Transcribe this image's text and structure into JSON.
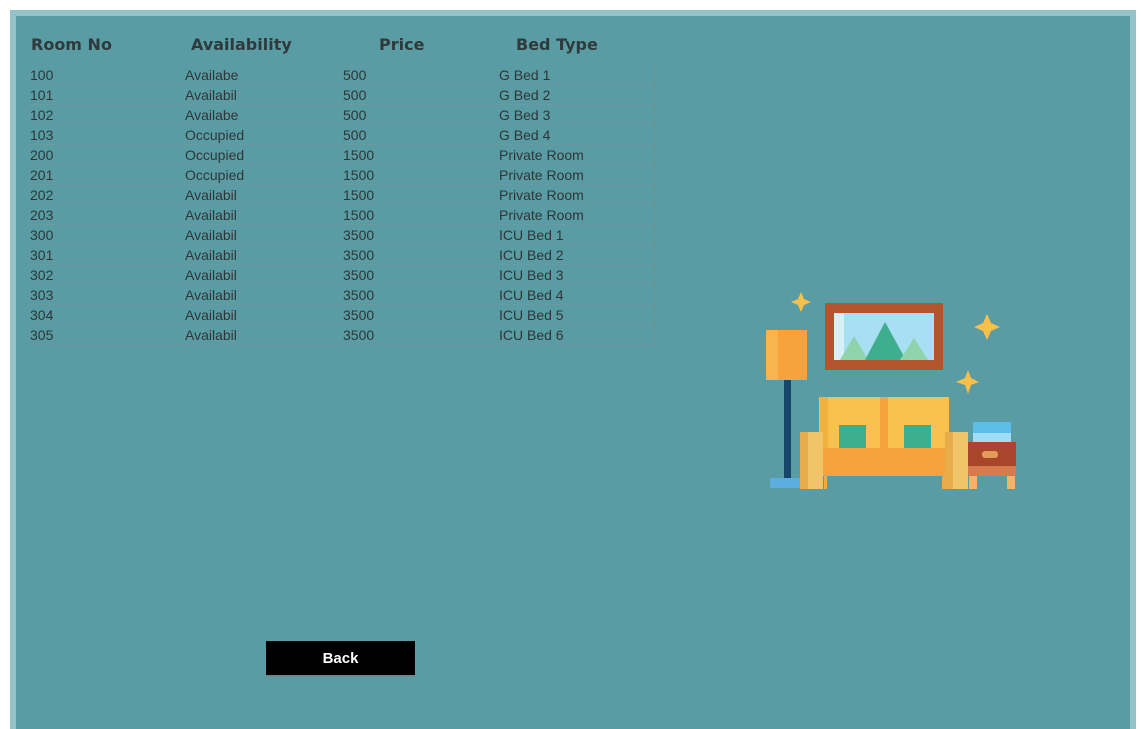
{
  "headers": {
    "room_no": "Room No",
    "availability": "Availability",
    "price": "Price",
    "bed_type": "Bed Type"
  },
  "rooms": [
    {
      "room": "100",
      "availability": "Availabe",
      "price": "500",
      "bed": "G Bed 1"
    },
    {
      "room": "101",
      "availability": "Availabil",
      "price": "500",
      "bed": "G Bed 2"
    },
    {
      "room": "102",
      "availability": "Availabe",
      "price": "500",
      "bed": "G Bed 3"
    },
    {
      "room": "103",
      "availability": "Occupied",
      "price": "500",
      "bed": "G Bed 4"
    },
    {
      "room": "200",
      "availability": "Occupied",
      "price": "1500",
      "bed": "Private Room"
    },
    {
      "room": "201",
      "availability": "Occupied",
      "price": "1500",
      "bed": "Private Room"
    },
    {
      "room": "202",
      "availability": "Availabil",
      "price": "1500",
      "bed": "Private Room"
    },
    {
      "room": "203",
      "availability": "Availabil",
      "price": "1500",
      "bed": "Private Room"
    },
    {
      "room": "300",
      "availability": "Availabil",
      "price": "3500",
      "bed": "ICU Bed 1"
    },
    {
      "room": "301",
      "availability": "Availabil",
      "price": "3500",
      "bed": "ICU Bed 2"
    },
    {
      "room": "302",
      "availability": "Availabil",
      "price": "3500",
      "bed": "ICU Bed 3"
    },
    {
      "room": "303",
      "availability": "Availabil",
      "price": "3500",
      "bed": "ICU Bed 4"
    },
    {
      "room": "304",
      "availability": "Availabil",
      "price": "3500",
      "bed": "ICU Bed 5"
    },
    {
      "room": "305",
      "availability": "Availabil",
      "price": "3500",
      "bed": "ICU Bed 6"
    }
  ],
  "back_button": "Back",
  "illustration_icon": "living-room-sofa-icon",
  "colors": {
    "background": "#5a9ca3",
    "frame": "#93c3c8",
    "button": "#000000"
  }
}
